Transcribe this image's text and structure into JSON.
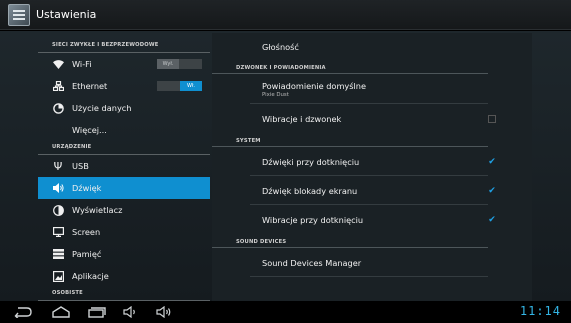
{
  "actionbar": {
    "title": "Ustawienia",
    "icon": "settings-app-icon"
  },
  "left": {
    "sections": [
      {
        "header": "SIECI ZWYKŁE I BEZPRZEWODOWE",
        "items": [
          {
            "name": "wifi",
            "label": "Wi-Fi",
            "icon": "wifi-icon",
            "toggle": {
              "state": "off",
              "label": "Wył."
            }
          },
          {
            "name": "ethernet",
            "label": "Ethernet",
            "icon": "ethernet-icon",
            "toggle": {
              "state": "on",
              "label": "Wł."
            }
          },
          {
            "name": "data-usage",
            "label": "Użycie danych",
            "icon": "data-usage-icon"
          },
          {
            "name": "more",
            "label": "Więcej..."
          }
        ]
      },
      {
        "header": "URZĄDZENIE",
        "items": [
          {
            "name": "usb",
            "label": "USB",
            "icon": "usb-icon"
          },
          {
            "name": "sound",
            "label": "Dźwięk",
            "icon": "speaker-icon",
            "selected": true
          },
          {
            "name": "display",
            "label": "Wyświetlacz",
            "icon": "display-icon"
          },
          {
            "name": "screen",
            "label": "Screen",
            "icon": "screen-icon"
          },
          {
            "name": "storage",
            "label": "Pamięć",
            "icon": "storage-icon"
          },
          {
            "name": "apps",
            "label": "Aplikacje",
            "icon": "apps-icon"
          }
        ]
      },
      {
        "header": "OSOBISTE",
        "items": []
      }
    ]
  },
  "right": {
    "top_item": {
      "title": "Głośność"
    },
    "categories": [
      {
        "header": "DZWONEK I POWIADOMIENIA",
        "items": [
          {
            "title": "Powiadomienie domyślne",
            "summary": "Pixie Dust"
          },
          {
            "title": "Wibracje i dzwonek",
            "checkbox": false
          }
        ]
      },
      {
        "header": "SYSTEM",
        "items": [
          {
            "title": "Dźwięki przy dotknięciu",
            "checkbox": true
          },
          {
            "title": "Dźwięk blokady ekranu",
            "checkbox": true
          },
          {
            "title": "Wibracje przy dotknięciu",
            "checkbox": true
          }
        ]
      },
      {
        "header": "SOUND DEVICES",
        "items": [
          {
            "title": "Sound Devices Manager"
          }
        ]
      }
    ]
  },
  "navbar": {
    "buttons": [
      "back-icon",
      "home-icon",
      "recents-icon",
      "volume-down-icon",
      "volume-up-icon"
    ],
    "clock": "11:14"
  },
  "colors": {
    "accent": "#0f8fd0",
    "clock": "#33b5e5",
    "check": "#1fa1e6"
  }
}
